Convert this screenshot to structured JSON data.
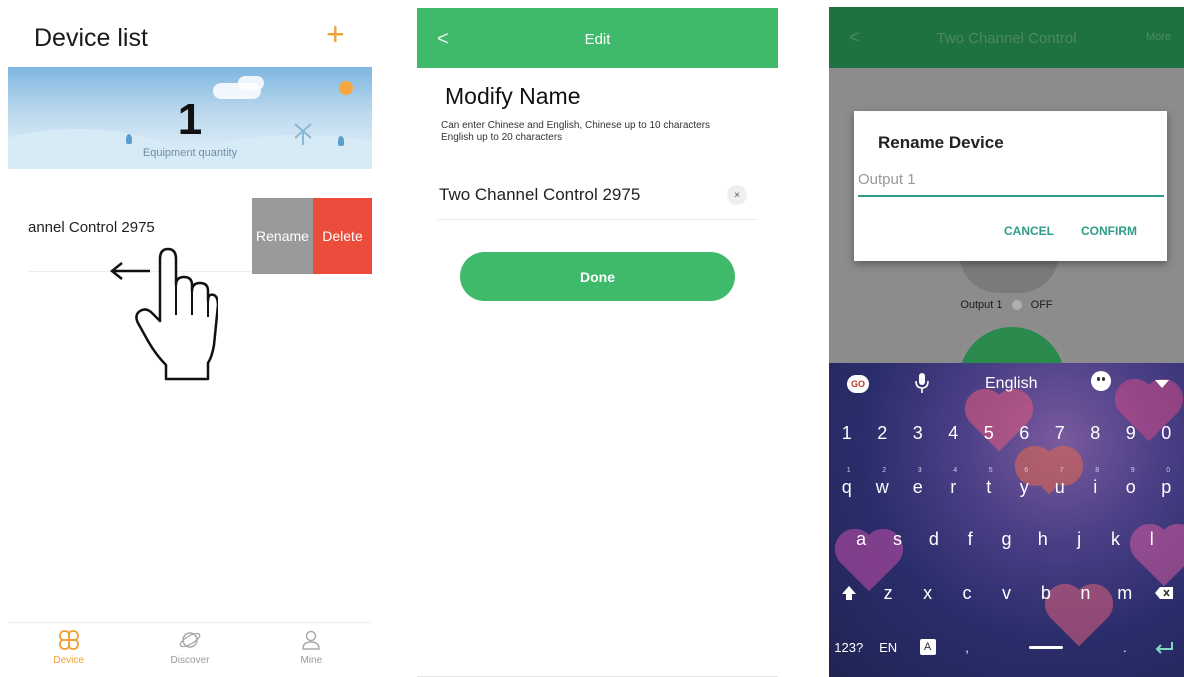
{
  "panel1": {
    "title": "Device list",
    "add_icon": "+",
    "count": "1",
    "count_label": "Equipment quantity",
    "device_name": "annel Control 2975",
    "rename_label": "Rename",
    "delete_label": "Delete",
    "tabs": [
      {
        "label": "Device",
        "icon": "device-grid-icon",
        "active": true
      },
      {
        "label": "Discover",
        "icon": "planet-icon",
        "active": false
      },
      {
        "label": "Mine",
        "icon": "user-icon",
        "active": false
      }
    ],
    "colors": {
      "accent": "#f0a030",
      "rename": "#9a9a9a",
      "delete": "#ec4c3c"
    }
  },
  "panel2": {
    "back_icon": "<",
    "title": "Edit",
    "heading": "Modify Name",
    "hint": "Can enter Chinese and English, Chinese up to 10 characters English up to 20 characters",
    "field_value": "Two Channel Control 2975",
    "clear_icon": "×",
    "done_label": "Done",
    "colors": {
      "primary": "#3fba6b"
    }
  },
  "panel3": {
    "back_icon": "<",
    "title": "Two Channel Control",
    "more_label": "More",
    "output_label": "Output 1",
    "output_state": "OFF",
    "dialog": {
      "title": "Rename Device",
      "input_placeholder": "Output 1",
      "cancel_label": "CANCEL",
      "confirm_label": "CONFIRM"
    },
    "keyboard": {
      "go_label": "GO",
      "mic_icon": "microphone-icon",
      "language": "English",
      "emoji_icon": "emoji-icon",
      "collapse_icon": "chevron-down-icon",
      "number_row": [
        "1",
        "2",
        "3",
        "4",
        "5",
        "6",
        "7",
        "8",
        "9",
        "0"
      ],
      "row_q": [
        "q",
        "w",
        "e",
        "r",
        "t",
        "y",
        "u",
        "i",
        "o",
        "p"
      ],
      "row_q_hints": [
        "1",
        "2",
        "3",
        "4",
        "5",
        "6",
        "7",
        "8",
        "9",
        "0"
      ],
      "row_a": [
        "a",
        "s",
        "d",
        "f",
        "g",
        "h",
        "j",
        "k",
        "l"
      ],
      "row_z": [
        "z",
        "x",
        "c",
        "v",
        "b",
        "n",
        "m"
      ],
      "shift_icon": "shift-icon",
      "backspace_icon": "backspace-icon",
      "symbols_label": "123?",
      "lang_switch_label": "EN",
      "comma": ",",
      "period": ".",
      "enter_icon": "enter-icon"
    },
    "colors": {
      "header": "#1e7141",
      "dialog_accent": "#2f9c86"
    }
  }
}
